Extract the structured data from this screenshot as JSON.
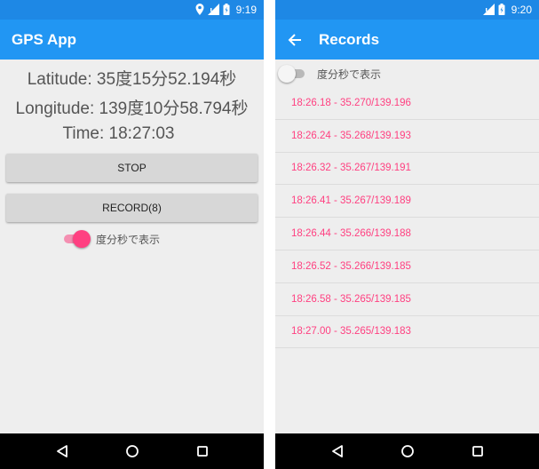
{
  "left": {
    "status_time": "9:19",
    "app_title": "GPS App",
    "latitude": "Latitude: 35度15分52.194秒",
    "longitude": "Longitude: 139度10分58.794秒",
    "time": "Time: 18:27:03",
    "stop_label": "STOP",
    "record_label": "RECORD(8)",
    "switch_label": "度分秒で表示"
  },
  "right": {
    "status_time": "9:20",
    "app_title": "Records",
    "switch_label": "度分秒で表示",
    "records": [
      "18:26.18 - 35.270/139.196",
      "18:26.24 - 35.268/139.193",
      "18:26.32 - 35.267/139.191",
      "18:26.41 - 35.267/139.189",
      "18:26.44 - 35.266/139.188",
      "18:26.52 - 35.266/139.185",
      "18:26.58 - 35.265/139.185",
      "18:27.00 - 35.265/139.183"
    ]
  },
  "colors": {
    "app_bar": "#2196f3",
    "status_bar": "#1e88e5",
    "accent": "#ff4081"
  }
}
